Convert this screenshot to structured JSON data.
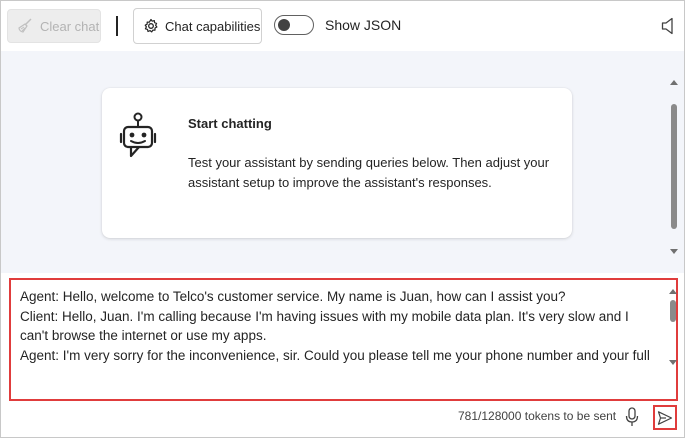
{
  "toolbar": {
    "clear_chat_label": "Clear chat",
    "chat_capabilities_label": "Chat capabilities",
    "show_json_label": "Show JSON",
    "show_json_on": false
  },
  "welcome_card": {
    "title": "Start chatting",
    "text": "Test your assistant by sending queries below. Then adjust your assistant setup to improve the assistant's responses."
  },
  "input": {
    "lines": [
      "Agent: Hello, welcome to Telco's customer service. My name is Juan, how can I assist you?",
      "Client: Hello, Juan. I'm calling because I'm having issues with my mobile data plan. It's very slow and I can't browse the internet or use my apps.",
      "Agent: I'm very sorry for the inconvenience, sir. Could you please tell me your phone number and your full name?"
    ]
  },
  "footer": {
    "token_count": "781/128000 tokens to be sent"
  },
  "icons": {
    "clear": "broom-icon",
    "capabilities": "gear-icon",
    "speaker": "speaker-icon",
    "bot": "bot-icon",
    "mic": "microphone-icon",
    "send": "send-icon"
  },
  "colors": {
    "highlight": "#e03c3c",
    "chat_background": "#f3f5fa"
  }
}
